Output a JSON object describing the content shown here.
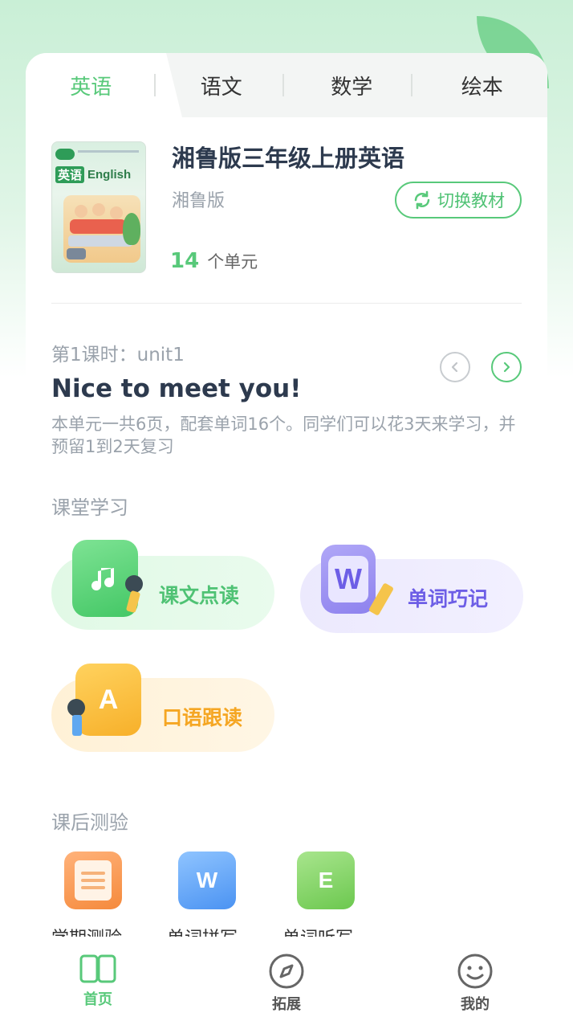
{
  "tabs": [
    {
      "label": "英语",
      "active": true
    },
    {
      "label": "语文",
      "active": false
    },
    {
      "label": "数学",
      "active": false
    },
    {
      "label": "绘本",
      "active": false
    }
  ],
  "book": {
    "cover_title_cn": "英语",
    "cover_title_en": "English",
    "title": "湘鲁版三年级上册英语",
    "edition": "湘鲁版",
    "switch_label": "切换教材",
    "unit_count": "14",
    "unit_count_label": "个单元"
  },
  "lesson": {
    "label": "第1课时：unit1",
    "name": "Nice to meet you!",
    "description": "本单元一共6页，配套单词16个。同学们可以花3天来学习，并预留1到2天复习"
  },
  "classroom": {
    "title": "课堂学习",
    "items": [
      {
        "label": "课文点读",
        "icon": "music-book-icon",
        "color": "#58c97a"
      },
      {
        "label": "单词巧记",
        "icon": "word-w-icon",
        "color": "#7b6ef0"
      },
      {
        "label": "口语跟读",
        "icon": "letter-a-icon",
        "color": "#f5a623"
      }
    ]
  },
  "quiz": {
    "title": "课后测验",
    "items": [
      {
        "label": "学期测验",
        "icon": "test-paper-icon"
      },
      {
        "label": "单词拼写",
        "icon": "word-spell-icon"
      },
      {
        "label": "单词听写",
        "icon": "word-dictation-icon"
      }
    ]
  },
  "bottom_nav": [
    {
      "label": "首页",
      "icon": "book-icon",
      "active": true
    },
    {
      "label": "拓展",
      "icon": "compass-icon",
      "active": false
    },
    {
      "label": "我的",
      "icon": "smiley-icon",
      "active": false
    }
  ],
  "colors": {
    "accent": "#58c97a",
    "text_dark": "#2d3a4e",
    "text_muted": "#9aa2ab"
  }
}
